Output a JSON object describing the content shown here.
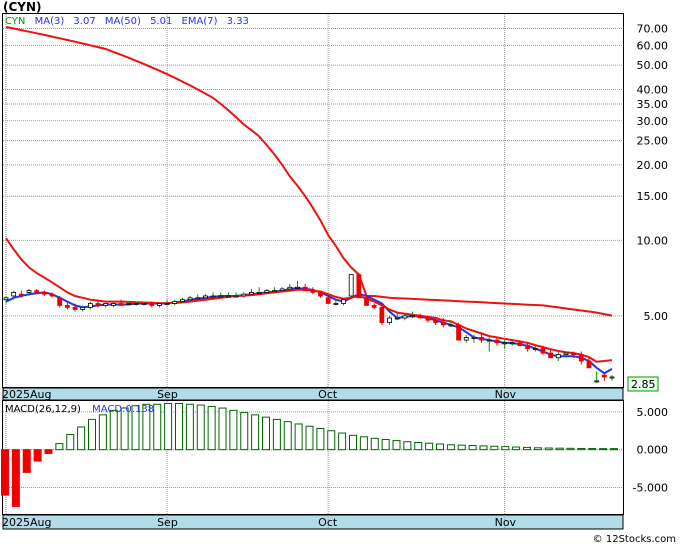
{
  "title": "(CYN)",
  "watermark": "© 12Stocks.com",
  "legend": {
    "symbol": "CYN",
    "ma3": "MA(3)",
    "ma3_value": "3.07",
    "ma50": "MA(50)",
    "ma50_value": "5.01",
    "ema7": "EMA(7)",
    "ema7_value": "3.33"
  },
  "last_price_label": "2.85",
  "macd": {
    "label": "MACD(26,12,9)",
    "value_label": "MACD:0.138"
  },
  "colors": {
    "ma50": "#ee1111",
    "ma3": "#2233ee",
    "ema7": "#ee1111",
    "up_candle": "#009900",
    "down_candle": "#ee0000",
    "macd_pos": "#006600",
    "macd_neg": "#ee0000",
    "axis_band": "#b4dce8",
    "last_price_box": "#e8ffe8"
  },
  "chart_data": [
    {
      "type": "candlestick",
      "scale": "log",
      "x": [
        "2025-08-01",
        "2025-08-04",
        "2025-08-05",
        "2025-08-06",
        "2025-08-07",
        "2025-08-08",
        "2025-08-11",
        "2025-08-12",
        "2025-08-13",
        "2025-08-14",
        "2025-08-15",
        "2025-08-18",
        "2025-08-19",
        "2025-08-20",
        "2025-08-21",
        "2025-08-22",
        "2025-08-25",
        "2025-08-26",
        "2025-08-27",
        "2025-08-28",
        "2025-08-29",
        "2025-09-02",
        "2025-09-03",
        "2025-09-04",
        "2025-09-05",
        "2025-09-08",
        "2025-09-09",
        "2025-09-10",
        "2025-09-11",
        "2025-09-12",
        "2025-09-15",
        "2025-09-16",
        "2025-09-17",
        "2025-09-18",
        "2025-09-19",
        "2025-09-22",
        "2025-09-23",
        "2025-09-24",
        "2025-09-25",
        "2025-09-26",
        "2025-09-29",
        "2025-09-30",
        "2025-10-01",
        "2025-10-02",
        "2025-10-03",
        "2025-10-06",
        "2025-10-07",
        "2025-10-08",
        "2025-10-09",
        "2025-10-10",
        "2025-10-13",
        "2025-10-14",
        "2025-10-15",
        "2025-10-16",
        "2025-10-17",
        "2025-10-20",
        "2025-10-21",
        "2025-10-22",
        "2025-10-23",
        "2025-10-24",
        "2025-10-27",
        "2025-10-28",
        "2025-10-29",
        "2025-10-30",
        "2025-10-31",
        "2025-11-03",
        "2025-11-04",
        "2025-11-05",
        "2025-11-06",
        "2025-11-07",
        "2025-11-10",
        "2025-11-11",
        "2025-11-12",
        "2025-11-13",
        "2025-11-14",
        "2025-11-17",
        "2025-11-18",
        "2025-11-19",
        "2025-11-20",
        "2025-11-21"
      ],
      "open": [
        5.8,
        6.0,
        6.1,
        6.2,
        6.3,
        6.2,
        6.1,
        5.9,
        5.5,
        5.4,
        5.3,
        5.4,
        5.6,
        5.5,
        5.5,
        5.6,
        5.6,
        5.6,
        5.6,
        5.6,
        5.5,
        5.6,
        5.6,
        5.7,
        5.8,
        5.9,
        5.9,
        6.0,
        6.0,
        6.0,
        6.0,
        6.0,
        6.1,
        6.2,
        6.2,
        6.3,
        6.3,
        6.4,
        6.5,
        6.5,
        6.3,
        6.2,
        5.9,
        5.6,
        5.6,
        6.0,
        7.3,
        5.9,
        5.5,
        5.4,
        4.7,
        4.9,
        4.9,
        5.0,
        5.0,
        4.9,
        4.8,
        4.7,
        4.6,
        4.6,
        4.0,
        4.1,
        4.1,
        4.0,
        4.0,
        3.9,
        3.9,
        3.9,
        3.8,
        3.7,
        3.7,
        3.55,
        3.4,
        3.5,
        3.55,
        3.5,
        3.3,
        2.75,
        2.9,
        2.85
      ],
      "high": [
        6.0,
        6.3,
        6.3,
        6.4,
        6.4,
        6.3,
        6.2,
        6.0,
        5.7,
        5.6,
        5.5,
        5.7,
        5.8,
        5.6,
        5.7,
        5.8,
        5.7,
        5.7,
        5.7,
        5.7,
        5.6,
        5.8,
        5.8,
        5.9,
        6.0,
        6.1,
        6.1,
        6.2,
        6.2,
        6.2,
        6.2,
        6.2,
        6.4,
        6.5,
        6.4,
        6.5,
        6.5,
        6.7,
        6.9,
        6.7,
        6.5,
        6.3,
        6.1,
        5.8,
        5.9,
        6.2,
        7.4,
        6.0,
        5.6,
        5.5,
        5.0,
        5.1,
        5.1,
        5.2,
        5.1,
        5.0,
        4.9,
        4.9,
        4.8,
        4.7,
        4.2,
        4.2,
        4.3,
        4.1,
        4.1,
        4.0,
        4.0,
        4.0,
        3.9,
        3.8,
        3.8,
        3.7,
        3.6,
        3.6,
        3.6,
        3.6,
        3.4,
        3.0,
        2.95,
        2.9
      ],
      "low": [
        5.6,
        5.8,
        5.9,
        6.0,
        6.1,
        6.0,
        5.9,
        5.4,
        5.3,
        5.2,
        5.2,
        5.3,
        5.4,
        5.4,
        5.4,
        5.5,
        5.5,
        5.5,
        5.5,
        5.4,
        5.4,
        5.5,
        5.5,
        5.6,
        5.7,
        5.8,
        5.8,
        5.9,
        5.9,
        5.9,
        5.9,
        5.9,
        6.0,
        6.1,
        6.1,
        6.2,
        6.2,
        6.3,
        6.4,
        6.3,
        6.1,
        5.9,
        5.6,
        5.5,
        5.5,
        5.9,
        5.9,
        5.5,
        5.3,
        4.6,
        4.6,
        4.8,
        4.8,
        4.9,
        4.9,
        4.7,
        4.6,
        4.5,
        4.5,
        4.0,
        3.9,
        3.9,
        3.9,
        3.6,
        3.8,
        3.7,
        3.8,
        3.8,
        3.6,
        3.6,
        3.5,
        3.4,
        3.3,
        3.4,
        3.4,
        3.2,
        3.1,
        2.7,
        2.75,
        2.75
      ],
      "close": [
        5.9,
        6.2,
        6.0,
        6.3,
        6.2,
        6.1,
        6.0,
        5.5,
        5.4,
        5.3,
        5.4,
        5.6,
        5.5,
        5.6,
        5.6,
        5.5,
        5.6,
        5.6,
        5.6,
        5.5,
        5.6,
        5.6,
        5.7,
        5.8,
        5.9,
        5.9,
        6.0,
        6.0,
        6.0,
        6.0,
        6.0,
        6.1,
        6.2,
        6.2,
        6.3,
        6.3,
        6.4,
        6.5,
        6.5,
        6.3,
        6.2,
        6.0,
        5.6,
        5.6,
        5.8,
        7.3,
        5.9,
        5.5,
        5.4,
        4.7,
        4.9,
        4.9,
        5.0,
        5.0,
        4.9,
        4.8,
        4.7,
        4.6,
        4.6,
        4.0,
        4.1,
        4.1,
        4.0,
        4.0,
        3.9,
        3.9,
        3.9,
        3.8,
        3.7,
        3.7,
        3.55,
        3.4,
        3.5,
        3.55,
        3.5,
        3.3,
        3.1,
        2.75,
        2.85,
        2.85
      ],
      "series": [
        {
          "name": "MA(50)",
          "values": [
            71,
            70,
            69,
            68,
            67,
            66,
            65,
            64,
            63,
            62,
            61,
            60,
            59,
            58,
            56.5,
            55,
            53.5,
            52,
            50.5,
            49,
            47.5,
            46,
            44.5,
            43,
            41.5,
            40,
            38.5,
            37,
            35,
            33,
            31,
            29,
            27.5,
            26,
            24,
            22,
            20,
            18,
            16.5,
            15,
            13.5,
            12,
            10.5,
            9.5,
            8.5,
            7.8,
            7.3,
            6.0,
            6.0,
            5.95,
            5.9,
            5.88,
            5.86,
            5.84,
            5.82,
            5.8,
            5.78,
            5.76,
            5.74,
            5.72,
            5.7,
            5.68,
            5.66,
            5.64,
            5.62,
            5.6,
            5.58,
            5.56,
            5.54,
            5.52,
            5.5,
            5.45,
            5.4,
            5.35,
            5.3,
            5.25,
            5.2,
            5.15,
            5.08,
            5.01
          ]
        },
        {
          "name": "MA(3)",
          "values": [
            5.7,
            5.9,
            6.0,
            6.1,
            6.15,
            6.2,
            6.1,
            5.9,
            5.7,
            5.5,
            5.4,
            5.45,
            5.5,
            5.55,
            5.55,
            5.55,
            5.55,
            5.6,
            5.6,
            5.6,
            5.6,
            5.6,
            5.65,
            5.7,
            5.8,
            5.85,
            5.9,
            5.95,
            6.0,
            6.0,
            6.0,
            6.05,
            6.1,
            6.15,
            6.2,
            6.25,
            6.3,
            6.4,
            6.45,
            6.4,
            6.35,
            6.2,
            6.0,
            5.8,
            5.7,
            5.9,
            6.1,
            6.0,
            5.8,
            5.6,
            5.2,
            4.9,
            4.95,
            5.0,
            4.95,
            4.9,
            4.8,
            4.7,
            4.6,
            4.5,
            4.3,
            4.1,
            4.05,
            4.0,
            3.95,
            3.9,
            3.9,
            3.85,
            3.8,
            3.7,
            3.6,
            3.5,
            3.45,
            3.45,
            3.45,
            3.4,
            3.3,
            3.1,
            2.95,
            3.07
          ]
        },
        {
          "name": "EMA(7)",
          "values": [
            10.2,
            9.2,
            8.4,
            7.8,
            7.4,
            7.1,
            6.8,
            6.5,
            6.2,
            6.0,
            5.9,
            5.8,
            5.75,
            5.7,
            5.7,
            5.7,
            5.68,
            5.66,
            5.65,
            5.64,
            5.62,
            5.62,
            5.63,
            5.65,
            5.7,
            5.75,
            5.8,
            5.85,
            5.9,
            5.95,
            6.0,
            6.02,
            6.05,
            6.1,
            6.15,
            6.2,
            6.25,
            6.3,
            6.35,
            6.35,
            6.3,
            6.25,
            6.1,
            5.95,
            5.85,
            5.9,
            6.0,
            5.85,
            5.7,
            5.5,
            5.3,
            5.15,
            5.1,
            5.05,
            5.0,
            4.95,
            4.9,
            4.8,
            4.75,
            4.6,
            4.45,
            4.35,
            4.25,
            4.15,
            4.1,
            4.05,
            4.0,
            3.95,
            3.9,
            3.82,
            3.75,
            3.68,
            3.62,
            3.58,
            3.55,
            3.5,
            3.42,
            3.28,
            3.3,
            3.33
          ]
        }
      ],
      "yticks": [
        70,
        60,
        50,
        40,
        35,
        30,
        25,
        20,
        15,
        10,
        5
      ],
      "ytick_labels": [
        "70.00",
        "60.00",
        "50.00",
        "40.00",
        "35.00",
        "30.00",
        "25.00",
        "20.00",
        "15.00",
        "10.00",
        "5.00"
      ],
      "ylim": [
        2.6,
        80
      ],
      "xtick_labels": [
        {
          "date": "2025-08-01",
          "label": "2025Aug"
        },
        {
          "date": "2025-09-02",
          "label": "Sep"
        },
        {
          "date": "2025-10-01",
          "label": "Oct"
        },
        {
          "date": "2025-11-03",
          "label": "Nov"
        }
      ]
    },
    {
      "type": "bar",
      "name": "MACD(26,12,9)",
      "values": [
        -6.0,
        -7.5,
        -3.0,
        -1.5,
        -0.5,
        0.8,
        2.0,
        3.0,
        4.0,
        4.6,
        5.2,
        5.5,
        5.8,
        6.0,
        6.0,
        6.1,
        6.1,
        6.0,
        5.9,
        5.7,
        5.5,
        5.2,
        4.9,
        4.6,
        4.3,
        4.0,
        3.7,
        3.4,
        3.1,
        2.8,
        2.5,
        2.2,
        1.9,
        1.7,
        1.5,
        1.35,
        1.2,
        1.05,
        0.95,
        0.85,
        0.75,
        0.65,
        0.6,
        0.55,
        0.5,
        0.45,
        0.4,
        0.35,
        0.3,
        0.25,
        0.22,
        0.2,
        0.18,
        0.16,
        0.15,
        0.14,
        0.138
      ],
      "yticks": [
        5,
        0,
        -5
      ],
      "ytick_labels": [
        "5.000",
        "0.000",
        "-5.000"
      ],
      "ylim": [
        -8.5,
        6.3
      ]
    }
  ]
}
